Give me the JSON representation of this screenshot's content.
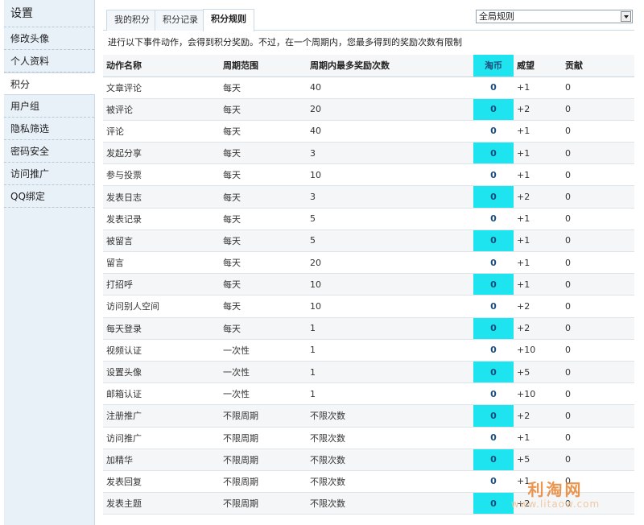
{
  "sidebar": {
    "title": "设置",
    "items": [
      {
        "label": "修改头像",
        "active": false
      },
      {
        "label": "个人资料",
        "active": false
      },
      {
        "label": "积分",
        "active": true
      },
      {
        "label": "用户组",
        "active": false
      },
      {
        "label": "隐私筛选",
        "active": false
      },
      {
        "label": "密码安全",
        "active": false
      },
      {
        "label": "访问推广",
        "active": false
      },
      {
        "label": "QQ绑定",
        "active": false
      }
    ]
  },
  "tabs": [
    {
      "label": "我的积分",
      "active": false
    },
    {
      "label": "积分记录",
      "active": false
    },
    {
      "label": "积分规则",
      "active": true
    }
  ],
  "scope_select": {
    "value": "全局规则"
  },
  "intro": "进行以下事件动作，会得到积分奖励。不过，在一个周期内，您最多得到的奖励次数有限制",
  "table": {
    "headers": [
      "动作名称",
      "周期范围",
      "周期内最多奖励次数",
      "淘币",
      "威望",
      "贡献"
    ],
    "rows": [
      [
        "文章评论",
        "每天",
        "40",
        "0",
        "+1",
        "0"
      ],
      [
        "被评论",
        "每天",
        "20",
        "0",
        "+2",
        "0"
      ],
      [
        "评论",
        "每天",
        "40",
        "0",
        "+1",
        "0"
      ],
      [
        "发起分享",
        "每天",
        "3",
        "0",
        "+1",
        "0"
      ],
      [
        "参与投票",
        "每天",
        "10",
        "0",
        "+1",
        "0"
      ],
      [
        "发表日志",
        "每天",
        "3",
        "0",
        "+2",
        "0"
      ],
      [
        "发表记录",
        "每天",
        "5",
        "0",
        "+1",
        "0"
      ],
      [
        "被留言",
        "每天",
        "5",
        "0",
        "+1",
        "0"
      ],
      [
        "留言",
        "每天",
        "20",
        "0",
        "+1",
        "0"
      ],
      [
        "打招呼",
        "每天",
        "10",
        "0",
        "+1",
        "0"
      ],
      [
        "访问别人空间",
        "每天",
        "10",
        "0",
        "+2",
        "0"
      ],
      [
        "每天登录",
        "每天",
        "1",
        "0",
        "+2",
        "0"
      ],
      [
        "视频认证",
        "一次性",
        "1",
        "0",
        "+10",
        "0"
      ],
      [
        "设置头像",
        "一次性",
        "1",
        "0",
        "+5",
        "0"
      ],
      [
        "邮箱认证",
        "一次性",
        "1",
        "0",
        "+10",
        "0"
      ],
      [
        "注册推广",
        "不限周期",
        "不限次数",
        "0",
        "+2",
        "0"
      ],
      [
        "访问推广",
        "不限周期",
        "不限次数",
        "0",
        "+1",
        "0"
      ],
      [
        "加精华",
        "不限周期",
        "不限次数",
        "0",
        "+5",
        "0"
      ],
      [
        "发表回复",
        "不限周期",
        "不限次数",
        "0",
        "+1",
        "0"
      ],
      [
        "发表主题",
        "不限周期",
        "不限次数",
        "0",
        "+2",
        "0"
      ]
    ]
  },
  "watermark": {
    "title": "利淘网",
    "url": "www.litaow.com"
  },
  "colors": {
    "highlight": "#1ee4f0",
    "sidebar_bg": "#e8f0f8",
    "border": "#c9d9e6"
  }
}
